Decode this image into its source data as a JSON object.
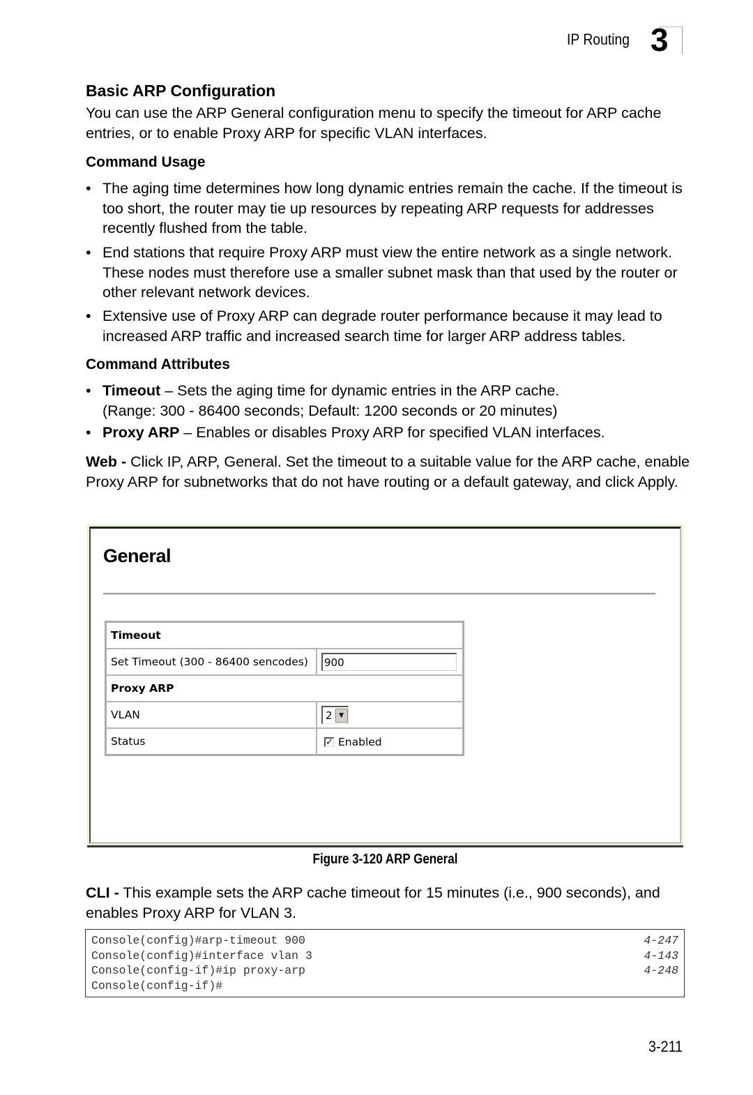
{
  "header": {
    "section": "IP Routing",
    "chapter": "3"
  },
  "title": "Basic ARP Configuration",
  "intro": "You can use the ARP General configuration menu to specify the timeout for ARP cache entries, or to enable Proxy ARP for specific VLAN interfaces.",
  "command_usage": {
    "heading": "Command Usage",
    "bullets": [
      "The aging time determines how long dynamic entries remain the cache. If the timeout is too short, the router may tie up resources by repeating ARP requests for addresses recently flushed from the table.",
      "End stations that require Proxy ARP must view the entire network as a single network. These nodes must therefore use a smaller subnet mask than that used by the router or other relevant network devices.",
      "Extensive use of Proxy ARP can degrade router performance because it may lead to increased ARP traffic and increased search time for larger ARP address tables."
    ]
  },
  "command_attributes": {
    "heading": "Command Attributes",
    "items": [
      {
        "term": "Timeout",
        "desc": " – Sets the aging time for dynamic entries in the ARP cache.",
        "extra": "(Range: 300 - 86400 seconds; Default: 1200 seconds or 20 minutes)"
      },
      {
        "term": "Proxy ARP",
        "desc": " – Enables or disables Proxy ARP for specified VLAN interfaces."
      }
    ]
  },
  "web": {
    "label": "Web -",
    "text": " Click IP, ARP, General. Set the timeout to a suitable value for the ARP cache, enable Proxy ARP for subnetworks that do not have routing or a default gateway, and click Apply."
  },
  "figure": {
    "title": "General",
    "timeout_header": "Timeout",
    "set_timeout_label": "Set Timeout (300 - 86400 sencodes)",
    "set_timeout_value": "900",
    "proxy_header": "Proxy ARP",
    "vlan_label": "VLAN",
    "vlan_value": "2",
    "status_label": "Status",
    "status_checked": true,
    "status_text": "Enabled",
    "caption": "Figure 3-120   ARP General"
  },
  "cli": {
    "label": "CLI -",
    "text": " This example sets the ARP cache timeout for 15 minutes (i.e., 900 seconds), and enables Proxy ARP for VLAN 3."
  },
  "code": [
    {
      "cmd": "Console(config)#arp-timeout 900",
      "ref": "4-247"
    },
    {
      "cmd": "Console(config)#interface vlan 3",
      "ref": "4-143"
    },
    {
      "cmd": "Console(config-if)#ip proxy-arp",
      "ref": "4-248"
    },
    {
      "cmd": "Console(config-if)#",
      "ref": ""
    }
  ],
  "page_number": "3-211"
}
